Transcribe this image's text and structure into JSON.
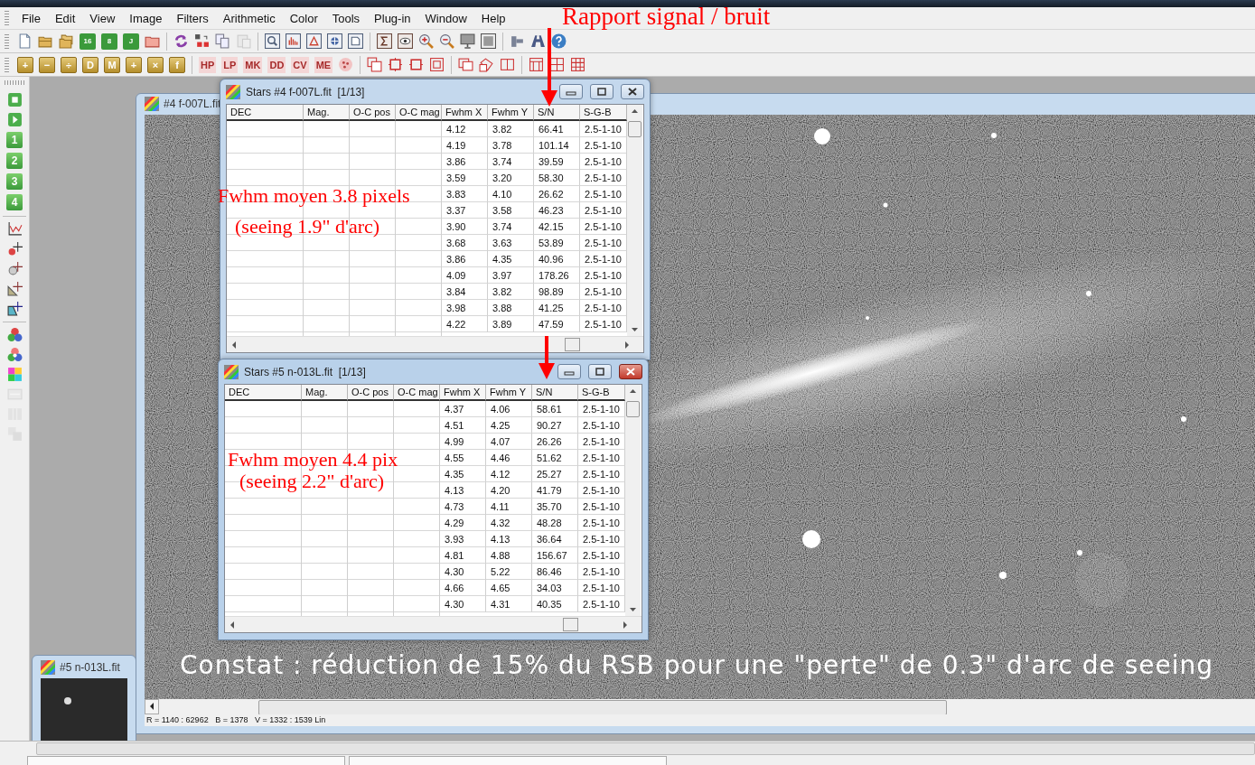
{
  "menu": [
    "File",
    "Edit",
    "View",
    "Image",
    "Filters",
    "Arithmetic",
    "Color",
    "Tools",
    "Plug-in",
    "Window",
    "Help"
  ],
  "toolbar_main": [
    {
      "kind": "page",
      "disabled": false
    },
    {
      "kind": "folder",
      "disabled": false
    },
    {
      "kind": "folders",
      "disabled": false
    },
    {
      "kind": "disk",
      "label": "16",
      "disabled": false
    },
    {
      "kind": "disk",
      "label": "8",
      "disabled": false
    },
    {
      "kind": "disk",
      "label": "J",
      "disabled": false
    },
    {
      "kind": "folder-red",
      "disabled": false
    },
    {
      "kind": "separator"
    },
    {
      "kind": "refresh",
      "disabled": false
    },
    {
      "kind": "split",
      "disabled": false
    },
    {
      "kind": "copy",
      "disabled": false
    },
    {
      "kind": "paste",
      "disabled": true
    },
    {
      "kind": "separator"
    },
    {
      "kind": "frame-zoom",
      "disabled": false
    },
    {
      "kind": "frame-hist",
      "disabled": false
    },
    {
      "kind": "frame-tri",
      "disabled": false
    },
    {
      "kind": "frame-globe",
      "disabled": false
    },
    {
      "kind": "frame-doc",
      "disabled": false
    },
    {
      "kind": "separator"
    },
    {
      "kind": "frame-sigma",
      "disabled": false
    },
    {
      "kind": "frame-eye",
      "disabled": false
    },
    {
      "kind": "zoom-in",
      "disabled": false
    },
    {
      "kind": "zoom-out",
      "disabled": false
    },
    {
      "kind": "monitor",
      "disabled": false
    },
    {
      "kind": "window",
      "disabled": false
    },
    {
      "kind": "separator"
    },
    {
      "kind": "tool",
      "disabled": false
    },
    {
      "kind": "pyramid",
      "disabled": false
    },
    {
      "kind": "help",
      "disabled": false
    }
  ],
  "toolbar_ops": [
    {
      "kind": "gold",
      "label": "+"
    },
    {
      "kind": "gold",
      "label": "−"
    },
    {
      "kind": "gold",
      "label": "÷"
    },
    {
      "kind": "gold",
      "label": "D"
    },
    {
      "kind": "gold",
      "label": "M"
    },
    {
      "kind": "gold",
      "label": "+"
    },
    {
      "kind": "gold",
      "label": "×"
    },
    {
      "kind": "gold",
      "label": "f"
    },
    {
      "kind": "separator"
    },
    {
      "kind": "filter",
      "label": "HP"
    },
    {
      "kind": "filter",
      "label": "LP"
    },
    {
      "kind": "filter",
      "label": "MK"
    },
    {
      "kind": "filter",
      "label": "DD"
    },
    {
      "kind": "filter",
      "label": "CV"
    },
    {
      "kind": "filter",
      "label": "ME"
    },
    {
      "kind": "flower"
    },
    {
      "kind": "separator"
    },
    {
      "kind": "rf-overlap"
    },
    {
      "kind": "rf-crop"
    },
    {
      "kind": "rf-crop2"
    },
    {
      "kind": "rf-square"
    },
    {
      "kind": "separator"
    },
    {
      "kind": "rf-two"
    },
    {
      "kind": "rf-rotate"
    },
    {
      "kind": "rf-columns"
    },
    {
      "kind": "separator"
    },
    {
      "kind": "grid-top"
    },
    {
      "kind": "grid-4"
    },
    {
      "kind": "grid-9"
    }
  ],
  "left_toolbar": [
    {
      "kind": "green-stop",
      "disabled": false
    },
    {
      "kind": "green-play",
      "disabled": false
    },
    {
      "kind": "green",
      "label": "1",
      "disabled": false
    },
    {
      "kind": "green",
      "label": "2",
      "disabled": false
    },
    {
      "kind": "green",
      "label": "3",
      "disabled": false
    },
    {
      "kind": "green",
      "label": "4",
      "disabled": false
    },
    {
      "kind": "separator"
    },
    {
      "kind": "chart",
      "disabled": false
    },
    {
      "kind": "star-red",
      "disabled": false
    },
    {
      "kind": "star-loupe",
      "disabled": false
    },
    {
      "kind": "star-triangle",
      "disabled": false
    },
    {
      "kind": "star-blue",
      "disabled": false
    },
    {
      "kind": "separator"
    },
    {
      "kind": "balls",
      "disabled": false
    },
    {
      "kind": "balls2",
      "disabled": false
    },
    {
      "kind": "colorgrid",
      "disabled": false
    },
    {
      "kind": "resize",
      "disabled": true
    },
    {
      "kind": "columns-grey",
      "disabled": true
    },
    {
      "kind": "stack-grey",
      "disabled": true
    }
  ],
  "image_window_back": {
    "title": "#5 n-013L.fit"
  },
  "image_window": {
    "title": "#4 f-007L.fit",
    "status_line": "R = 1140 : 62962   B = 1378   V = 1332 : 1539 Lin"
  },
  "star_tables": [
    {
      "title": "Stars #4 f-007L.fit  [1/13]",
      "active": false,
      "columns": [
        "DEC",
        "Mag.",
        "O-C pos",
        "O-C mag",
        "Fwhm X",
        "Fwhm Y",
        "S/N",
        "S-G-B"
      ],
      "rows": [
        [
          "4.12",
          "3.82",
          "66.41",
          "2.5-1-10"
        ],
        [
          "4.19",
          "3.78",
          "101.14",
          "2.5-1-10"
        ],
        [
          "3.86",
          "3.74",
          "39.59",
          "2.5-1-10"
        ],
        [
          "3.59",
          "3.20",
          "58.30",
          "2.5-1-10"
        ],
        [
          "3.83",
          "4.10",
          "26.62",
          "2.5-1-10"
        ],
        [
          "3.37",
          "3.58",
          "46.23",
          "2.5-1-10"
        ],
        [
          "3.90",
          "3.74",
          "42.15",
          "2.5-1-10"
        ],
        [
          "3.68",
          "3.63",
          "53.89",
          "2.5-1-10"
        ],
        [
          "3.86",
          "4.35",
          "40.96",
          "2.5-1-10"
        ],
        [
          "4.09",
          "3.97",
          "178.26",
          "2.5-1-10"
        ],
        [
          "3.84",
          "3.82",
          "98.89",
          "2.5-1-10"
        ],
        [
          "3.98",
          "3.88",
          "41.25",
          "2.5-1-10"
        ],
        [
          "4.22",
          "3.89",
          "47.59",
          "2.5-1-10"
        ]
      ]
    },
    {
      "title": "Stars #5 n-013L.fit  [1/13]",
      "active": true,
      "columns": [
        "DEC",
        "Mag.",
        "O-C pos",
        "O-C mag",
        "Fwhm X",
        "Fwhm Y",
        "S/N",
        "S-G-B"
      ],
      "rows": [
        [
          "4.37",
          "4.06",
          "58.61",
          "2.5-1-10"
        ],
        [
          "4.51",
          "4.25",
          "90.27",
          "2.5-1-10"
        ],
        [
          "4.99",
          "4.07",
          "26.26",
          "2.5-1-10"
        ],
        [
          "4.55",
          "4.46",
          "51.62",
          "2.5-1-10"
        ],
        [
          "4.35",
          "4.12",
          "25.27",
          "2.5-1-10"
        ],
        [
          "4.13",
          "4.20",
          "41.79",
          "2.5-1-10"
        ],
        [
          "4.73",
          "4.11",
          "35.70",
          "2.5-1-10"
        ],
        [
          "4.29",
          "4.32",
          "48.28",
          "2.5-1-10"
        ],
        [
          "3.93",
          "4.13",
          "36.64",
          "2.5-1-10"
        ],
        [
          "4.81",
          "4.88",
          "156.67",
          "2.5-1-10"
        ],
        [
          "4.30",
          "5.22",
          "86.46",
          "2.5-1-10"
        ],
        [
          "4.66",
          "4.65",
          "34.03",
          "2.5-1-10"
        ],
        [
          "4.30",
          "4.31",
          "40.35",
          "2.5-1-10"
        ]
      ]
    }
  ],
  "annotations": [
    {
      "kind": "red",
      "text": "Rapport signal / bruit"
    },
    {
      "kind": "red",
      "text": "Fwhm moyen 3.8 pixels"
    },
    {
      "kind": "red",
      "text": "(seeing 1.9\" d'arc)"
    },
    {
      "kind": "red",
      "text": "Fwhm moyen 4.4 pix"
    },
    {
      "kind": "red",
      "text": "(seeing 2.2\" d'arc)"
    },
    {
      "kind": "white",
      "text": "Constat : réduction de 15% du RSB pour une \"perte\" de 0.3\" d'arc de seeing"
    }
  ]
}
